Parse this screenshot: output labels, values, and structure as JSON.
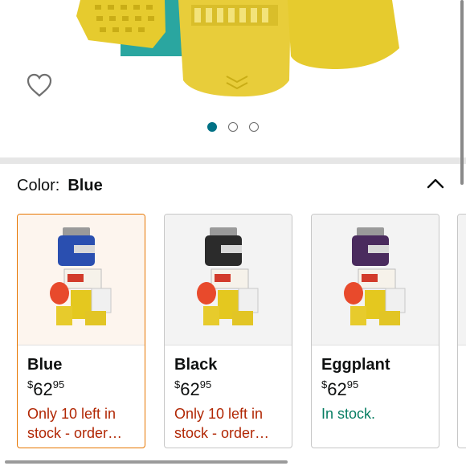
{
  "hero": {
    "wishlist_icon": "heart-outline-icon",
    "dots": 3,
    "active_dot": 0
  },
  "color_selector": {
    "label": "Color:",
    "selected": "Blue",
    "collapse_icon": "chevron-up-icon"
  },
  "options": [
    {
      "name": "Blue",
      "currency": "$",
      "whole": "62",
      "cents": "95",
      "availability": "Only 10 left in stock - order…",
      "status": "low",
      "selected": true,
      "accent": "#2a4fb0"
    },
    {
      "name": "Black",
      "currency": "$",
      "whole": "62",
      "cents": "95",
      "availability": "Only 10 left in stock - order…",
      "status": "low",
      "selected": false,
      "accent": "#2b2b2b"
    },
    {
      "name": "Eggplant",
      "currency": "$",
      "whole": "62",
      "cents": "95",
      "availability": "In stock.",
      "status": "ok",
      "selected": false,
      "accent": "#4a2b5e"
    }
  ],
  "colors": {
    "selected_border": "#e77600",
    "low_stock": "#b12704",
    "in_stock": "#067d62",
    "active_dot": "#007185"
  }
}
